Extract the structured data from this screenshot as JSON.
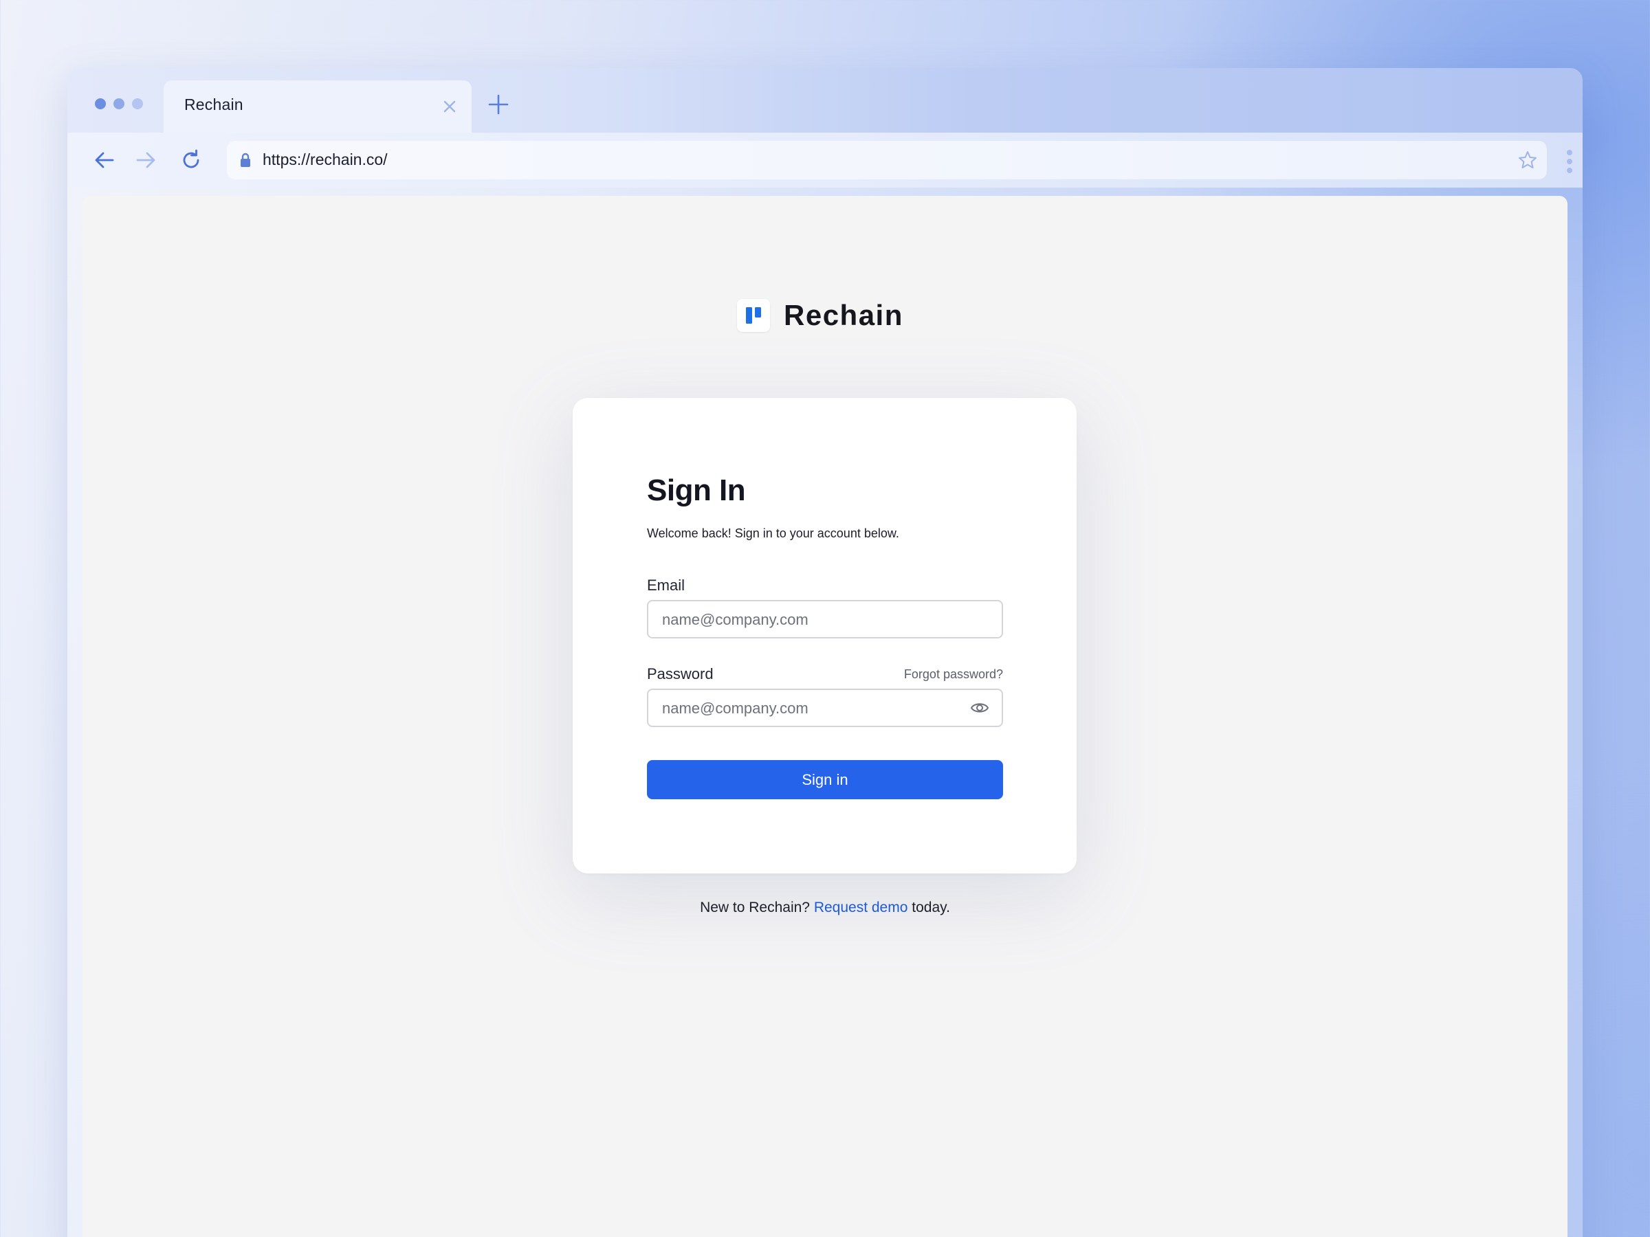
{
  "browser": {
    "tab_title": "Rechain",
    "url": "https://rechain.co/"
  },
  "brand": {
    "name": "Rechain"
  },
  "signin": {
    "title": "Sign In",
    "subtitle": "Welcome back! Sign in to your account below.",
    "email_label": "Email",
    "email_placeholder": "name@company.com",
    "password_label": "Password",
    "forgot_label": "Forgot password?",
    "password_placeholder": "name@company.com",
    "button_label": "Sign in"
  },
  "footer": {
    "prefix": "New to Rechain?",
    "link": "Request demo",
    "suffix": "today."
  },
  "colors": {
    "accent": "#2563eb",
    "link": "#1d5ad8",
    "page_bg": "#f4f4f5"
  }
}
